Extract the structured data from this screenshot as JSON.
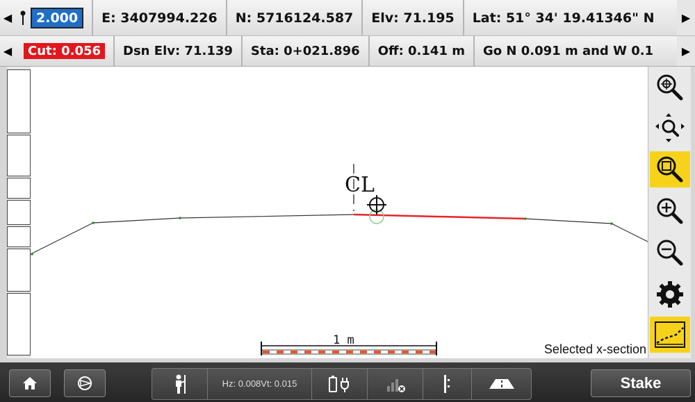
{
  "header_row1": {
    "target_height": "2.000",
    "easting": "E: 3407994.226",
    "northing": "N: 5716124.587",
    "elevation": "Elv: 71.195",
    "latitude": "Lat: 51° 34' 19.41346\" N"
  },
  "header_row2": {
    "cut": "Cut: 0.056",
    "design_elevation": "Dsn Elv: 71.139",
    "station": "Sta: 0+021.896",
    "offset": "Off: 0.141 m",
    "go_direction": "Go N 0.091 m and W 0.1"
  },
  "canvas": {
    "centerline_label": "CL",
    "scale_label": "1 m",
    "selected_label": "Selected x-section"
  },
  "toolbar": {
    "icons": [
      "zoom-target-icon",
      "pan-icon",
      "zoom-extents-icon",
      "zoom-in-icon",
      "zoom-out-icon",
      "gear-icon",
      "cross-section-icon"
    ],
    "active_color": "#f6d31a"
  },
  "status": {
    "hz": "Hz: 0.008",
    "vt": "Vt: 0.015"
  },
  "buttons": {
    "stake": "Stake"
  },
  "colors": {
    "cut_bg": "#e2161d",
    "target_bg": "#1e6fc8",
    "selected_segment": "#e8232a",
    "scale_bar": "#e8552a"
  }
}
